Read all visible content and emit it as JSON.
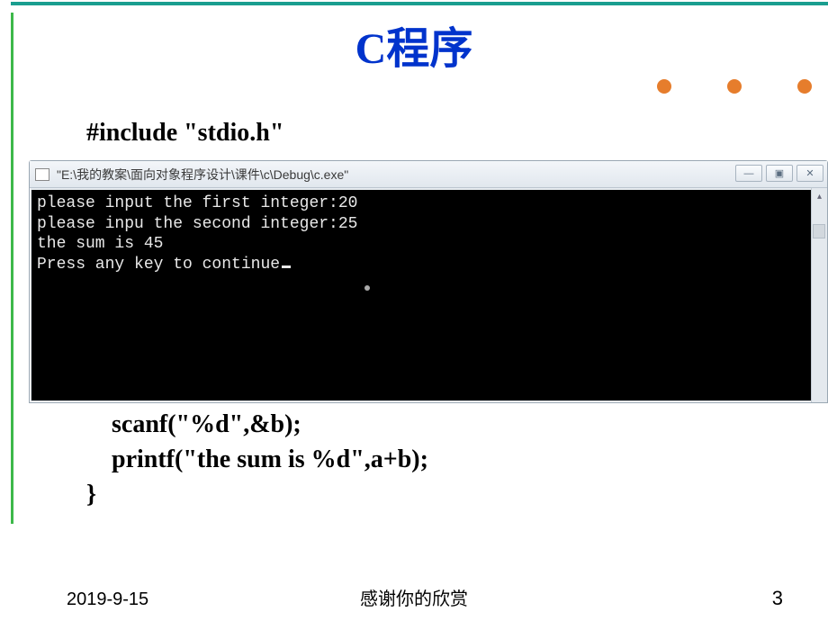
{
  "title": "C程序",
  "code_top": "#include \"stdio.h\"",
  "console": {
    "title": "\"E:\\我的教案\\面向对象程序设计\\课件\\c\\Debug\\c.exe\"",
    "lines": [
      "please input the first integer:20",
      "please inpu the second integer:25",
      "the sum is 45",
      "Press any key to continue"
    ],
    "minimize": "—",
    "maximize": "▣",
    "close": "✕"
  },
  "code_bottom_lines": {
    "l1_indent": "    scanf(\"%d\",&b);",
    "l2_indent": "    printf(\"the sum is %d\",a+b);",
    "l3": "}"
  },
  "footer": {
    "date": "2019-9-15",
    "center": "感谢你的欣赏",
    "page": "3"
  }
}
